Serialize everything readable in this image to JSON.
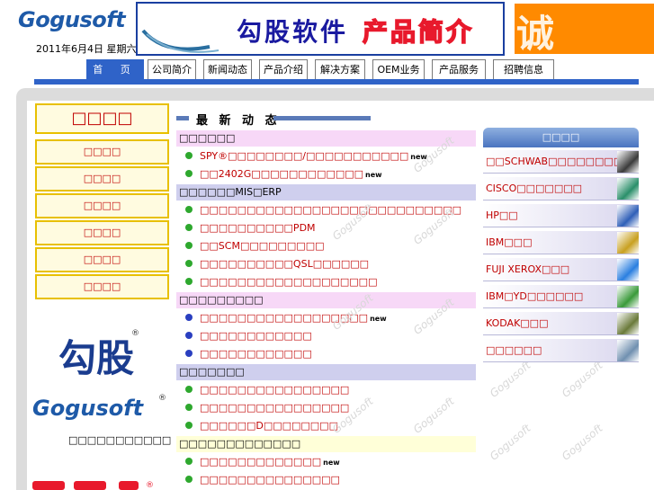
{
  "header": {
    "logo": "Gogusoft",
    "date": "2011年6月4日 星期六",
    "banner_text": "勾股软件",
    "banner_sub": "产品简介",
    "side_char": "诚"
  },
  "nav": {
    "tabs": [
      "首 页",
      "公司简介",
      "新闻动态",
      "产品介绍",
      "解决方案",
      "OEM业务",
      "产品服务",
      "招聘信息"
    ]
  },
  "left": {
    "title": "□□□□",
    "items": [
      "□□□□",
      "□□□□",
      "□□□□",
      "□□□□",
      "□□□□",
      "□□□□"
    ],
    "brand_mark": "勾股",
    "brand_en": "Gogusoft",
    "brand_cn": "□□□□□□□□□□□"
  },
  "news": {
    "heading": "最 新 动 态",
    "sections": [
      {
        "title": "□□□□□□",
        "style": "pink",
        "items": [
          {
            "text": "SPY®□□□□□□□□/□□□□□□□□□□□",
            "new": true,
            "dot": "green"
          },
          {
            "text": "□□2402G□□□□□□□□□□□□",
            "new": true,
            "dot": "green"
          }
        ]
      },
      {
        "title": "□□□□□□MIS□ERP",
        "style": "lav",
        "items": [
          {
            "text": "□□□□□□□□□□□□□□□□□□□□□□□□□□□□",
            "new": false,
            "dot": "green"
          },
          {
            "text": "□□□□□□□□□□PDM",
            "new": false,
            "dot": "green"
          },
          {
            "text": "□□SCM□□□□□□□□□",
            "new": false,
            "dot": "green"
          },
          {
            "text": "□□□□□□□□□□QSL□□□□□□",
            "new": false,
            "dot": "green"
          },
          {
            "text": "□□□□□□□□□□□□□□□□□□□",
            "new": false,
            "dot": "green"
          }
        ]
      },
      {
        "title": "□□□□□□□□□",
        "style": "pink",
        "items": [
          {
            "text": "□□□□□□□□□□□□□□□□□□",
            "new": true,
            "dot": "blue"
          },
          {
            "text": "□□□□□□□□□□□□",
            "new": false,
            "dot": "blue"
          },
          {
            "text": "□□□□□□□□□□□□",
            "new": false,
            "dot": "blue"
          }
        ]
      },
      {
        "title": "□□□□□□□",
        "style": "lav",
        "items": [
          {
            "text": "□□□□□□□□□□□□□□□□",
            "new": false,
            "dot": "green"
          },
          {
            "text": "□□□□□□□□□□□□□□□□",
            "new": false,
            "dot": "green"
          },
          {
            "text": "□□□□□□D□□□□□□□□",
            "new": false,
            "dot": "green"
          }
        ]
      },
      {
        "title": "□□□□□□□□□□□□□",
        "style": "yel",
        "items": [
          {
            "text": "□□□□□□□□□□□□□",
            "new": true,
            "dot": "green"
          },
          {
            "text": "□□□□□□□□□□□□□□□",
            "new": false,
            "dot": "green"
          }
        ]
      }
    ],
    "new_label": "new",
    "watermark": "Gogusoft"
  },
  "clients": {
    "heading": "□□□□",
    "items": [
      {
        "label": "□□SCHWAB□□□□□□□□",
        "thumb_color": "#3b3b3b"
      },
      {
        "label": "CISCO□□□□□□□",
        "thumb_color": "#2a8f6a"
      },
      {
        "label": "HP□□",
        "thumb_color": "#2f5fb8"
      },
      {
        "label": "IBM□□□",
        "thumb_color": "#c8a020"
      },
      {
        "label": "FUJI XEROX□□□",
        "thumb_color": "#2a7fe0"
      },
      {
        "label": "IBM□YD□□□□□□",
        "thumb_color": "#3a9a3a"
      },
      {
        "label": "KODAK□□□",
        "thumb_color": "#6a7a3a"
      },
      {
        "label": "□□□□□□",
        "thumb_color": "#7090b0"
      }
    ]
  },
  "colors": {
    "nav_blue": "#2f63c8",
    "link_red": "#c00000",
    "logo_blue": "#1e5aa8"
  }
}
